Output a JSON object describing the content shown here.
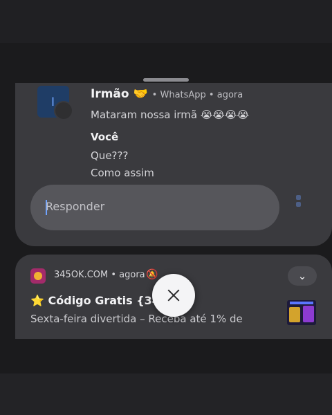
{
  "whatsapp_notification": {
    "avatar_letter": "I",
    "sender": "Irmão 🤝",
    "app": "• WhatsApp • agora",
    "messages": [
      "Mataram nossa irmã 😭😭😭😭"
    ],
    "self_label": "Você",
    "self_messages": [
      "Que???",
      "Como assim"
    ],
    "reply_placeholder": "Responder"
  },
  "promo_notification": {
    "app_line": "345OK.COM • agora",
    "bell_icon": "bell-off-icon",
    "chevron": "⌄",
    "title_star": "⭐",
    "title": "Código Gratis {34552",
    "body": "Sexta-feira divertida – Receba até 1% de"
  },
  "dismiss_icon": "close-icon",
  "colors": {
    "card_background": "#3a3a3e",
    "screen_background": "#1b1b1d",
    "accent_blue": "#6fa3ff"
  }
}
